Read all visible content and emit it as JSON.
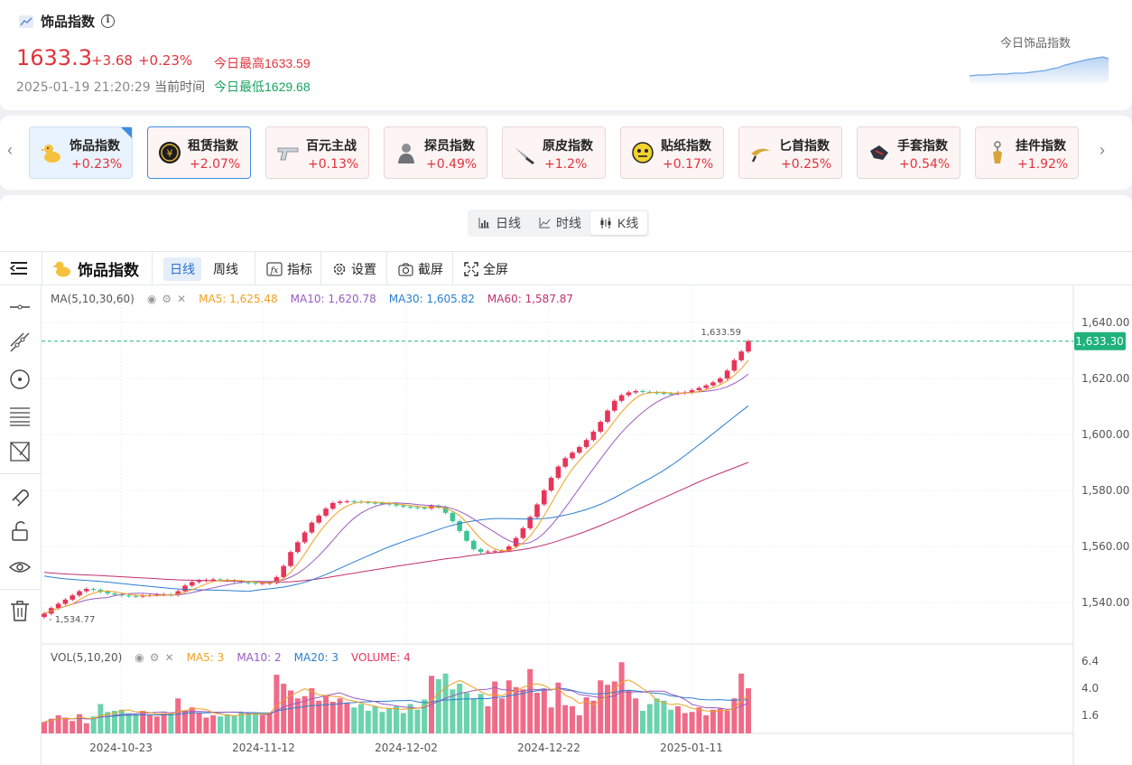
{
  "header": {
    "title": "饰品指数",
    "price": "1633.3",
    "change": "+3.68",
    "change_pct": "+0.23%",
    "high_label": "今日最高1633.59",
    "low_label": "今日最低1629.68",
    "datetime": "2025-01-19 21:20:29",
    "time_label": "当前时间",
    "mini_chart_label": "今日饰品指数"
  },
  "categories": [
    {
      "name": "饰品指数",
      "pct": "+0.23%",
      "icon": "duck-icon"
    },
    {
      "name": "租赁指数",
      "pct": "+2.07%",
      "icon": "coin-icon"
    },
    {
      "name": "百元主战",
      "pct": "+0.13%",
      "icon": "pistol-icon"
    },
    {
      "name": "探员指数",
      "pct": "+0.49%",
      "icon": "agent-icon"
    },
    {
      "name": "原皮指数",
      "pct": "+1.2%",
      "icon": "knife-icon"
    },
    {
      "name": "贴纸指数",
      "pct": "+0.17%",
      "icon": "sticker-icon"
    },
    {
      "name": "匕首指数",
      "pct": "+0.25%",
      "icon": "karambit-icon"
    },
    {
      "name": "手套指数",
      "pct": "+0.54%",
      "icon": "glove-icon"
    },
    {
      "name": "挂件指数",
      "pct": "+1.92%",
      "icon": "charm-icon"
    }
  ],
  "view_tabs": [
    {
      "label": "日线",
      "icon": "bar-chart-icon"
    },
    {
      "label": "时线",
      "icon": "line-chart-icon"
    },
    {
      "label": "K线",
      "icon": "candlestick-icon"
    }
  ],
  "toolbar": {
    "symbol": "饰品指数",
    "daily": "日线",
    "weekly": "周线",
    "indicators": "指标",
    "settings": "设置",
    "screenshot": "截屏",
    "fullscreen": "全屏"
  },
  "main_legend": {
    "name": "MA(5,10,30,60)",
    "ma5": "MA5: 1,625.48",
    "ma10": "MA10: 1,620.78",
    "ma30": "MA30: 1,605.82",
    "ma60": "MA60: 1,587.87"
  },
  "vol_legend": {
    "name": "VOL(5,10,20)",
    "ma5": "MA5: 3",
    "ma10": "MA10: 2",
    "ma20": "MA20: 3",
    "volume": "VOLUME: 4"
  },
  "price_axis": [
    "1,640.00",
    "1,620.00",
    "1,600.00",
    "1,580.00",
    "1,560.00",
    "1,540.00"
  ],
  "vol_axis": [
    "6.4",
    "4.0",
    "1.6"
  ],
  "date_axis": [
    "2024-10-23",
    "2024-11-12",
    "2024-12-02",
    "2024-12-22",
    "2025-01-11"
  ],
  "last_price_tag": "1,633.30",
  "max_label": "1,633.59",
  "min_label": "1,534.77",
  "colors": {
    "up": "#e8345a",
    "down": "#3cc595",
    "ma5": "#f0a020",
    "ma10": "#9a5cc0",
    "ma30": "#2a7fd0",
    "ma60": "#c0306e",
    "last": "#1fb27a"
  },
  "chart_data": {
    "type": "candlestick",
    "close": [
      1536.0,
      1538.0,
      1539.5,
      1541.0,
      1542.5,
      1544.0,
      1544.8,
      1544.5,
      1543.8,
      1543.2,
      1542.8,
      1542.5,
      1542.3,
      1542.2,
      1542.4,
      1542.6,
      1542.8,
      1542.8,
      1542.7,
      1544.0,
      1546.0,
      1547.3,
      1547.8,
      1548.0,
      1548.2,
      1548.0,
      1547.8,
      1547.5,
      1547.2,
      1547.0,
      1546.8,
      1546.9,
      1547.0,
      1549.0,
      1553.0,
      1558.0,
      1561.5,
      1565.0,
      1568.5,
      1571.0,
      1573.5,
      1575.5,
      1576.0,
      1576.1,
      1576.0,
      1575.8,
      1575.6,
      1575.5,
      1575.3,
      1575.0,
      1574.6,
      1574.2,
      1574.0,
      1573.8,
      1573.6,
      1574.5,
      1574.0,
      1572.0,
      1569.0,
      1565.5,
      1562.0,
      1559.0,
      1558.0,
      1558.2,
      1558.3,
      1558.5,
      1560.0,
      1563.0,
      1566.5,
      1570.5,
      1575.0,
      1580.0,
      1584.5,
      1588.5,
      1591.5,
      1593.5,
      1595.5,
      1598.0,
      1601.0,
      1604.5,
      1608.5,
      1612.0,
      1614.0,
      1615.0,
      1615.5,
      1615.2,
      1615.0,
      1614.8,
      1614.6,
      1614.5,
      1614.8,
      1615.0,
      1615.8,
      1616.6,
      1617.5,
      1618.6,
      1620.0,
      1622.8,
      1626.5,
      1629.6,
      1633.3
    ],
    "volume": [
      1.0,
      1.3,
      1.6,
      1.4,
      1.1,
      1.7,
      0.9,
      1.5,
      2.6,
      1.9,
      2.0,
      2.1,
      1.8,
      1.7,
      2.0,
      1.6,
      1.5,
      1.8,
      1.7,
      3.1,
      2.0,
      2.3,
      1.8,
      1.4,
      1.6,
      1.5,
      1.7,
      1.6,
      1.9,
      1.7,
      1.8,
      1.6,
      1.8,
      5.2,
      4.4,
      3.8,
      3.1,
      3.3,
      4.0,
      2.9,
      3.4,
      2.8,
      3.1,
      2.7,
      2.3,
      2.6,
      2.0,
      2.4,
      1.9,
      2.2,
      2.4,
      1.8,
      2.6,
      2.1,
      3.0,
      5.1,
      4.8,
      5.3,
      3.9,
      4.4,
      3.6,
      3.1,
      3.5,
      2.4,
      4.6,
      3.1,
      4.7,
      4.1,
      3.9,
      5.7,
      3.6,
      3.9,
      2.3,
      4.5,
      2.5,
      2.4,
      1.6,
      3.2,
      2.9,
      4.7,
      4.3,
      4.6,
      6.3,
      3.8,
      3.1,
      2.0,
      2.6,
      3.1,
      2.9,
      2.1,
      2.4,
      1.8,
      1.9,
      2.3,
      1.6,
      2.1,
      2.2,
      2.0,
      3.1,
      5.3,
      4.0
    ]
  }
}
